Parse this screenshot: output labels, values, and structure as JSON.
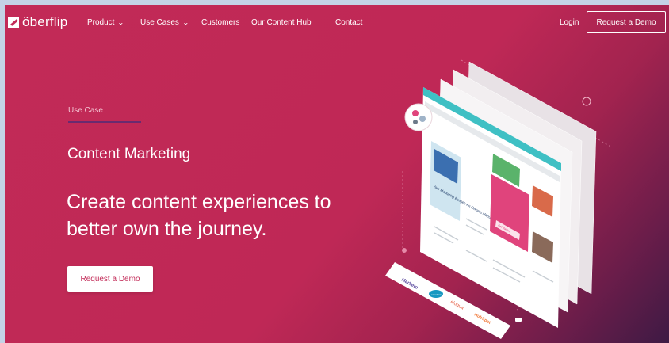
{
  "nav": {
    "logo_text": "öberflip",
    "items": [
      {
        "label": "Product",
        "has_dropdown": true
      },
      {
        "label": "Use Cases",
        "has_dropdown": true
      },
      {
        "label": "Customers",
        "has_dropdown": false
      },
      {
        "label": "Our Content Hub",
        "has_dropdown": false
      },
      {
        "label": "Contact",
        "has_dropdown": false
      }
    ],
    "login": "Login",
    "demo_button": "Request a Demo"
  },
  "hero": {
    "eyebrow": "Use Case",
    "subtitle": "Content Marketing",
    "headline": "Create content experiences to better own the journey.",
    "cta": "Request a Demo"
  },
  "illustration": {
    "book_title": "Your Marketing Budget: An Owners Manual",
    "partner_logos": [
      "Marketo",
      "salesforce",
      "eloqua",
      "HubSpot"
    ],
    "promo_button": "Get started"
  },
  "colors": {
    "background": "#c22a57",
    "gradient_end": "#3e1a44",
    "eyebrow_line": "#6a2a6f",
    "teal_accent": "#3fc0c4",
    "pink_accent": "#e0447c"
  },
  "icons": [
    "dropdown-chevron-icon",
    "people-badge-icon"
  ]
}
